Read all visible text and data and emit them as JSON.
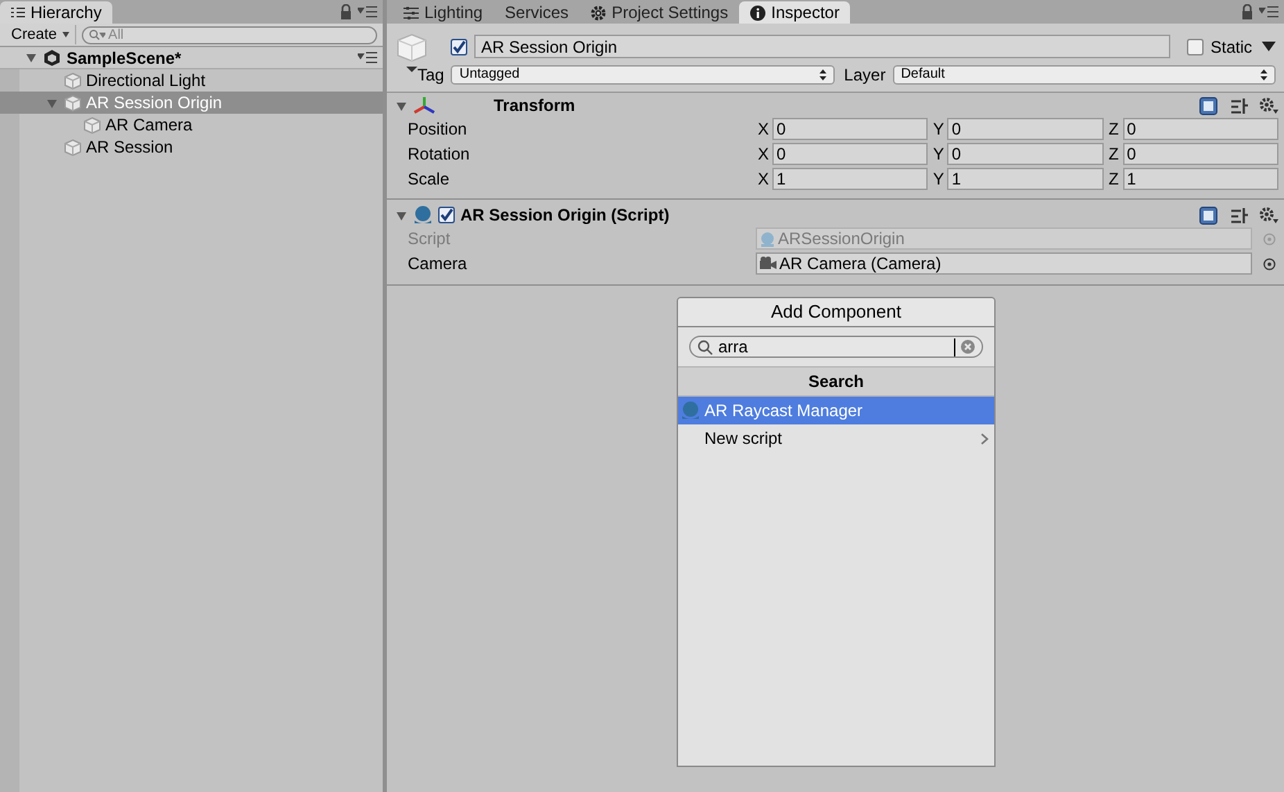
{
  "hierarchy": {
    "tab": "Hierarchy",
    "create": "Create",
    "search_placeholder": "All",
    "scene": {
      "name": "SampleScene*",
      "expanded": true,
      "children": [
        {
          "label": "Directional Light",
          "selected": false
        },
        {
          "label": "AR Session Origin",
          "selected": true,
          "expanded": true,
          "children": [
            {
              "label": "AR Camera",
              "selected": false
            }
          ]
        },
        {
          "label": "AR Session",
          "selected": false
        }
      ]
    }
  },
  "tabs": [
    {
      "label": "Lighting",
      "kind": "sliders",
      "selected": false
    },
    {
      "label": "Services",
      "kind": "plain",
      "selected": false
    },
    {
      "label": "Project Settings",
      "kind": "gear",
      "selected": false
    },
    {
      "label": "Inspector",
      "kind": "info",
      "selected": true
    }
  ],
  "object": {
    "active": true,
    "name": "AR Session Origin",
    "static": false,
    "static_label": "Static",
    "tag_label": "Tag",
    "tag": "Untagged",
    "layer_label": "Layer",
    "layer": "Default"
  },
  "transform": {
    "title": "Transform",
    "expanded": true,
    "rows": [
      {
        "label": "Position",
        "values": [
          {
            "axis": "X",
            "value": "0"
          },
          {
            "axis": "Y",
            "value": "0"
          },
          {
            "axis": "Z",
            "value": "0"
          }
        ]
      },
      {
        "label": "Rotation",
        "values": [
          {
            "axis": "X",
            "value": "0"
          },
          {
            "axis": "Y",
            "value": "0"
          },
          {
            "axis": "Z",
            "value": "0"
          }
        ]
      },
      {
        "label": "Scale",
        "values": [
          {
            "axis": "X",
            "value": "1"
          },
          {
            "axis": "Y",
            "value": "1"
          },
          {
            "axis": "Z",
            "value": "1"
          }
        ]
      }
    ]
  },
  "script_component": {
    "title": "AR Session Origin (Script)",
    "enabled": true,
    "expanded": true,
    "fields": [
      {
        "label": "Script",
        "value": "ARSessionOrigin",
        "kind": "script",
        "disabled": true
      },
      {
        "label": "Camera",
        "value": "AR Camera (Camera)",
        "kind": "camera",
        "disabled": false
      }
    ]
  },
  "add_component": {
    "label": "Add Component",
    "search": "arra",
    "header": "Search",
    "items": [
      {
        "label": "AR Raycast Manager",
        "kind": "script",
        "selected": true
      },
      {
        "label": "New script",
        "kind": "submenu",
        "selected": false
      }
    ]
  }
}
